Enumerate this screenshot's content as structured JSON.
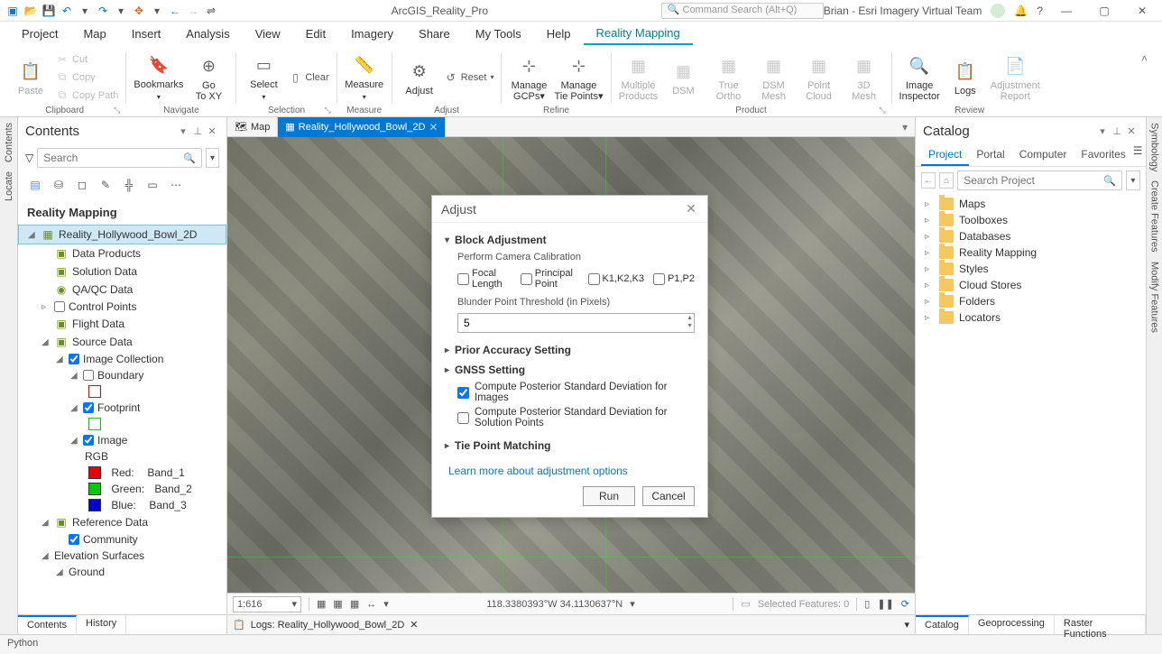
{
  "titlebar": {
    "app_title": "ArcGIS_Reality_Pro",
    "cmd_placeholder": "Command Search (Alt+Q)",
    "user": "Brian  -  Esri Imagery Virtual Team"
  },
  "ribbon_tabs": {
    "project": "Project",
    "map": "Map",
    "insert": "Insert",
    "analysis": "Analysis",
    "view": "View",
    "edit": "Edit",
    "imagery": "Imagery",
    "share": "Share",
    "my_tools": "My Tools",
    "help": "Help",
    "reality": "Reality Mapping"
  },
  "ribbon": {
    "clipboard": {
      "group": "Clipboard",
      "paste": "Paste",
      "cut": "Cut",
      "copy": "Copy",
      "copy_path": "Copy Path"
    },
    "navigate": {
      "group": "Navigate",
      "bookmarks": "Bookmarks",
      "goto_xy_l1": "Go",
      "goto_xy_l2": "To XY"
    },
    "selection": {
      "group": "Selection",
      "select": "Select",
      "clear": "Clear"
    },
    "measure": {
      "group": "Measure",
      "measure": "Measure"
    },
    "adjust": {
      "group": "Adjust",
      "adjust": "Adjust",
      "reset": "Reset"
    },
    "refine": {
      "group": "Refine",
      "gcps_l1": "Manage",
      "gcps_l2": "GCPs",
      "tp_l1": "Manage",
      "tp_l2": "Tie Points"
    },
    "product": {
      "group": "Product",
      "multi_l1": "Multiple",
      "multi_l2": "Products",
      "dsm": "DSM",
      "true_l1": "True",
      "true_l2": "Ortho",
      "dsm_mesh_l1": "DSM",
      "dsm_mesh_l2": "Mesh",
      "pc_l1": "Point",
      "pc_l2": "Cloud",
      "mesh3d_l1": "3D",
      "mesh3d_l2": "Mesh"
    },
    "review": {
      "group": "Review",
      "img_l1": "Image",
      "img_l2": "Inspector",
      "logs": "Logs",
      "adj_l1": "Adjustment",
      "adj_l2": "Report"
    }
  },
  "contents_panel": {
    "title": "Contents",
    "search_placeholder": "Search",
    "section_title": "Reality Mapping",
    "root": "Reality_Hollywood_Bowl_2D",
    "data_products": "Data Products",
    "solution_data": "Solution Data",
    "qaqc": "QA/QC Data",
    "control_points": "Control Points",
    "flight_data": "Flight Data",
    "source_data": "Source Data",
    "image_collection": "Image Collection",
    "boundary": "Boundary",
    "footprint": "Footprint",
    "image": "Image",
    "rgb": "RGB",
    "band_red_label": "Red:",
    "band_red_val": "Band_1",
    "band_green_label": "Green:",
    "band_green_val": "Band_2",
    "band_blue_label": "Blue:",
    "band_blue_val": "Band_3",
    "reference_data": "Reference Data",
    "community": "Community",
    "elevation_surfaces": "Elevation Surfaces",
    "ground": "Ground",
    "bottom_contents": "Contents",
    "bottom_history": "History"
  },
  "side_tabs_left": {
    "contents": "Contents",
    "locate": "Locate"
  },
  "side_tabs_right": {
    "symbology": "Symbology",
    "create": "Create Features",
    "modify": "Modify Features"
  },
  "map": {
    "tab_map": "Map",
    "tab_active": "Reality_Hollywood_Bowl_2D",
    "scale": "1:616",
    "coords": "118.3380393°W 34.1130637°N",
    "selected_features": "Selected Features: 0",
    "logs_tab": "Logs: Reality_Hollywood_Bowl_2D"
  },
  "catalog": {
    "title": "Catalog",
    "tab_project": "Project",
    "tab_portal": "Portal",
    "tab_computer": "Computer",
    "tab_favorites": "Favorites",
    "search_placeholder": "Search Project",
    "items": {
      "maps": "Maps",
      "toolboxes": "Toolboxes",
      "databases": "Databases",
      "reality": "Reality Mapping",
      "styles": "Styles",
      "cloud": "Cloud Stores",
      "folders": "Folders",
      "locators": "Locators"
    },
    "bottom_catalog": "Catalog",
    "bottom_geoprocessing": "Geoprocessing",
    "bottom_raster": "Raster Functions"
  },
  "dialog": {
    "title": "Adjust",
    "block_adjustment": "Block Adjustment",
    "perform_cal": "Perform Camera Calibration",
    "focal": "Focal Length",
    "principal": "Principal Point",
    "k123": "K1,K2,K3",
    "p12": "P1,P2",
    "blunder_label": "Blunder Point Threshold (in Pixels)",
    "blunder_value": "5",
    "prior_accuracy": "Prior Accuracy Setting",
    "gnss": "GNSS Setting",
    "compute_img": "Compute Posterior Standard Deviation for Images",
    "compute_sol": "Compute Posterior Standard Deviation for Solution Points",
    "tie_point": "Tie Point Matching",
    "learn_more": "Learn more about adjustment options",
    "run": "Run",
    "cancel": "Cancel"
  },
  "bottom_status": {
    "python": "Python"
  }
}
